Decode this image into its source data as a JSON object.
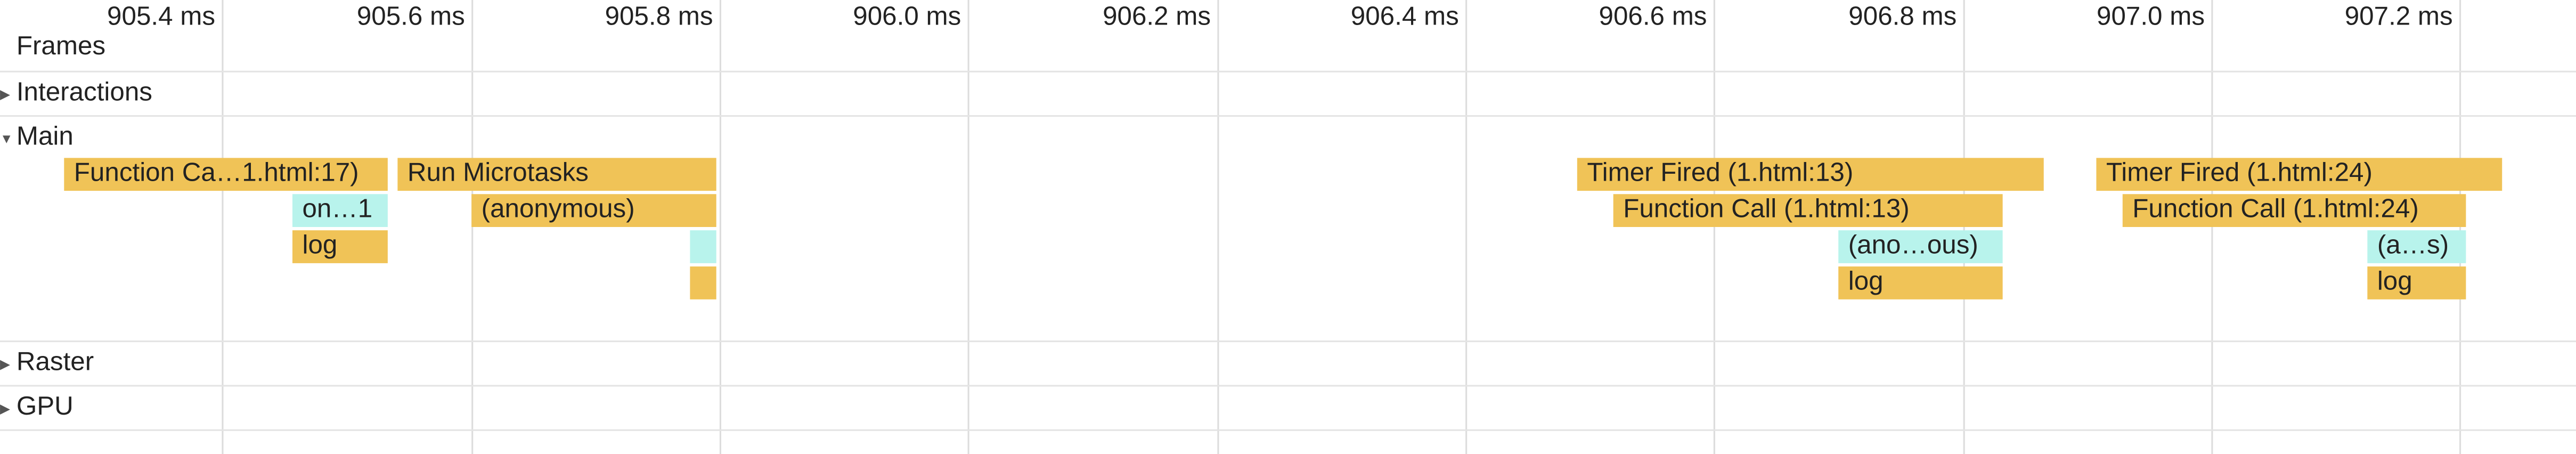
{
  "timeline": {
    "ticks": [
      "905.4 ms",
      "905.6 ms",
      "905.8 ms",
      "906.0 ms",
      "906.2 ms",
      "906.4 ms",
      "906.6 ms",
      "906.8 ms",
      "907.0 ms",
      "907.2 ms"
    ]
  },
  "tracks": {
    "frames": "Frames",
    "interactions": "Interactions",
    "main": "Main",
    "raster": "Raster",
    "gpu": "GPU"
  },
  "flame": {
    "func_call_17": "Function Ca…1.html:17)",
    "run_microtasks": "Run Microtasks",
    "on1": "on…1",
    "anonymous": "(anonymous)",
    "log_1": "log",
    "timer_13": "Timer Fired (1.html:13)",
    "func_call_13": "Function Call (1.html:13)",
    "anon_13": "(ano…ous)",
    "log_13": "log",
    "timer_24": "Timer Fired (1.html:24)",
    "func_call_24": "Function Call (1.html:24)",
    "anon_24": "(a…s)",
    "log_24": "log"
  },
  "colors": {
    "scripting": "#f0c357",
    "microtask": "#b8f3ec"
  }
}
